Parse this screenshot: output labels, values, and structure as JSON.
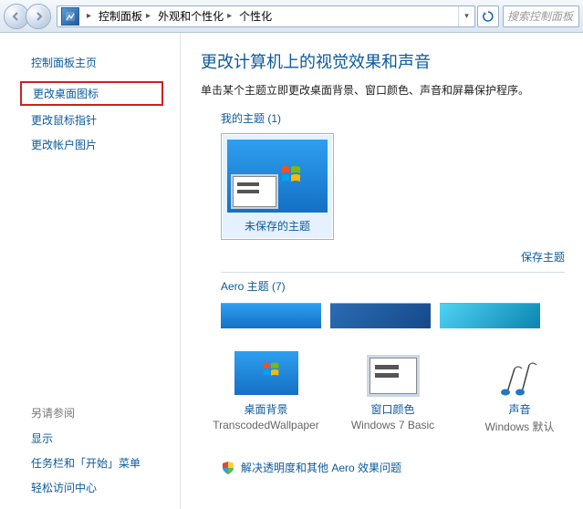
{
  "breadcrumb": {
    "root": "控制面板",
    "level1": "外观和个性化",
    "level2": "个性化"
  },
  "search": {
    "placeholder": "搜索控制面板"
  },
  "sidebar": {
    "home": "控制面板主页",
    "links": {
      "desktop_icons": "更改桌面图标",
      "mouse_pointers": "更改鼠标指针",
      "account_picture": "更改帐户图片"
    },
    "see_also_h": "另请参阅",
    "see_also": {
      "display": "显示",
      "taskbar": "任务栏和「开始」菜单",
      "ease": "轻松访问中心"
    }
  },
  "main": {
    "title": "更改计算机上的视觉效果和声音",
    "desc": "单击某个主题立即更改桌面背景、窗口颜色、声音和屏幕保护程序。",
    "my_themes_h": "我的主题 (1)",
    "unsaved_theme": "未保存的主题",
    "save_theme": "保存主题",
    "aero_h": "Aero 主题 (7)"
  },
  "bottom": {
    "bg_link": "桌面背景",
    "bg_sub": "TranscodedWallpaper",
    "color_link": "窗口颜色",
    "color_sub": "Windows 7 Basic",
    "sound_link": "声音",
    "sound_sub": "Windows 默认"
  },
  "trouble": "解决透明度和其他 Aero 效果问题"
}
